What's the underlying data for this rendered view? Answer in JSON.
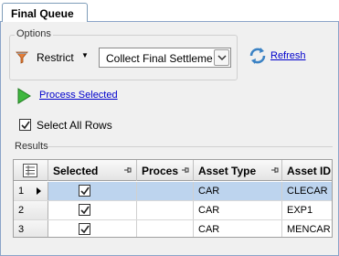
{
  "tab": {
    "label": "Final Queue"
  },
  "options": {
    "group_label": "Options",
    "restrict_label": "Restrict",
    "select_value": "Collect Final Settlement",
    "refresh_label": "Refresh"
  },
  "actions": {
    "process_label": "Process Selected",
    "select_all_label": "Select All Rows",
    "select_all_checked": true
  },
  "results": {
    "group_label": "Results",
    "columns": [
      "Selected",
      "Proces",
      "Asset Type",
      "Asset ID"
    ],
    "rows": [
      {
        "num": "1",
        "selected": true,
        "process": "",
        "asset_type": "CAR",
        "asset_id": "CLECAR",
        "current": true
      },
      {
        "num": "2",
        "selected": true,
        "process": "",
        "asset_type": "CAR",
        "asset_id": "EXP1",
        "current": false
      },
      {
        "num": "3",
        "selected": true,
        "process": "",
        "asset_type": "CAR",
        "asset_id": "MENCAR",
        "current": false
      }
    ]
  },
  "colors": {
    "selected_row": "#bdd4ee",
    "link": "#0000cc",
    "border": "#8ba4c8"
  }
}
